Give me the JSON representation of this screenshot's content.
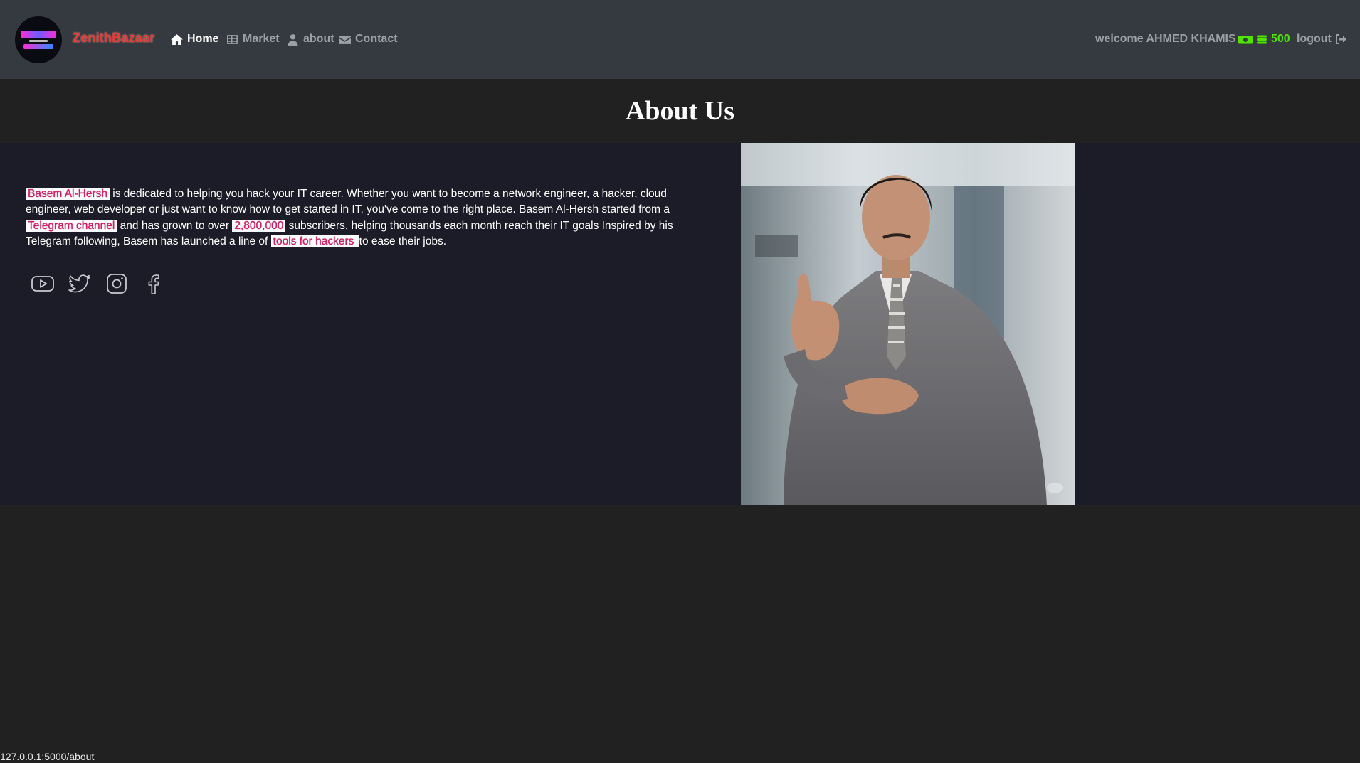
{
  "navbar": {
    "brand": "ZenithBazaar",
    "links": [
      {
        "label": "Home",
        "icon": "home-icon",
        "active": true
      },
      {
        "label": "Market",
        "icon": "table-icon",
        "active": false
      },
      {
        "label": "about",
        "icon": "user-icon",
        "active": false
      },
      {
        "label": "Contact",
        "icon": "envelope-icon",
        "active": false
      }
    ],
    "welcome": "welcome AHMED KHAMIS",
    "budget": "500",
    "logout": "logout"
  },
  "page": {
    "title": "About Us"
  },
  "about": {
    "name_highlight": "Basem Al-Hersh",
    "text1": " is dedicated to helping you hack your IT career. Whether you want to become a network engineer, a hacker, cloud engineer, web developer or just want to know how to get started in IT, you've come to the right place. Basem Al-Hersh started from a ",
    "channel_highlight": "Telegram channel",
    "text2": " and has grown to over ",
    "subs_highlight": "2,800,000",
    "text3": " subscribers, helping thousands each month reach their IT goals Inspired by his Telegram following, Basem has launched a line of ",
    "tools_highlight": "tools for hackers ",
    "text4": " to ease their jobs."
  },
  "socials": [
    "youtube-icon",
    "twitter-icon",
    "instagram-icon",
    "facebook-icon"
  ],
  "status_url": "127.0.0.1:5000/about",
  "colors": {
    "navbar_bg": "#343a40",
    "page_bg": "#212121",
    "section_bg": "#1b1c27",
    "brand": "#e53935",
    "budget": "#4ce600",
    "highlight_text": "#d81b60"
  }
}
